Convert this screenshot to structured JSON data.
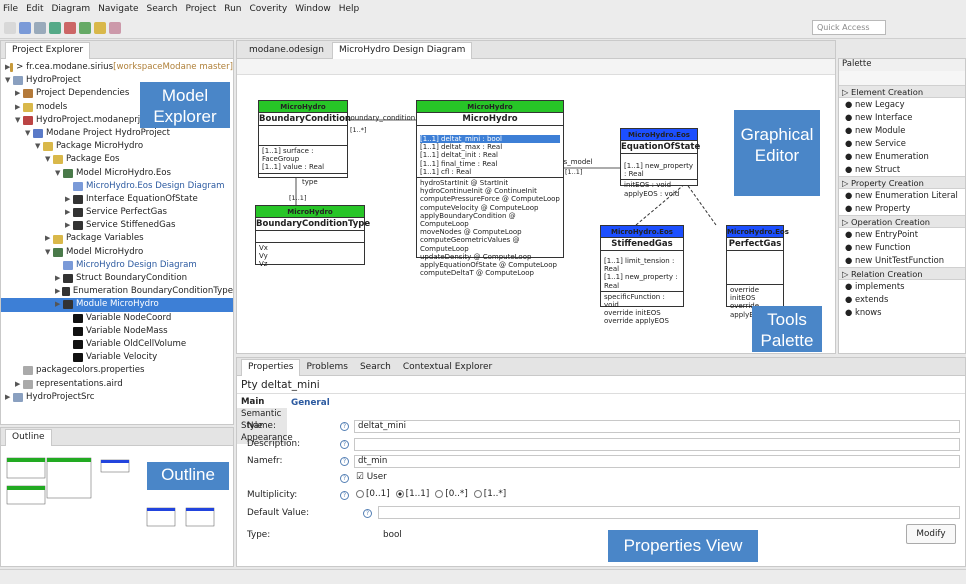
{
  "menu": [
    "File",
    "Edit",
    "Diagram",
    "Navigate",
    "Search",
    "Project",
    "Run",
    "Coverity",
    "Window",
    "Help"
  ],
  "quick_access": "Quick Access",
  "explorer": {
    "tab": "Project Explorer",
    "items": [
      {
        "t": "> fr.cea.modane.sirius",
        "s": " [workspaceModane master]",
        "ind": 0,
        "ar": "▶",
        "c": "#c79a3a"
      },
      {
        "t": "HydroProject",
        "ind": 0,
        "ar": "▼",
        "c": "#8aa0c0"
      },
      {
        "t": "Project Dependencies",
        "ind": 1,
        "ar": "▶",
        "c": "#b47a3a"
      },
      {
        "t": "models",
        "ind": 1,
        "ar": "▶",
        "c": "#d9b84a"
      },
      {
        "t": "HydroProject.modaneprj",
        "ind": 1,
        "ar": "▼",
        "c": "#b44"
      },
      {
        "t": "Modane Project HydroProject",
        "ind": 2,
        "ar": "▼",
        "c": "#5a7ac8"
      },
      {
        "t": "Package MicroHydro",
        "ind": 3,
        "ar": "▼",
        "c": "#d9b84a"
      },
      {
        "t": "Package Eos",
        "ind": 4,
        "ar": "▼",
        "c": "#d9b84a"
      },
      {
        "t": "Model MicroHydro.Eos",
        "ind": 5,
        "ar": "▼",
        "c": "#4a7a4a"
      },
      {
        "t": "MicroHydro.Eos Design Diagram",
        "ind": 6,
        "ar": "",
        "c": "#7a9ad8",
        "lnk": true
      },
      {
        "t": "Interface EquationOfState",
        "ind": 6,
        "ar": "▶",
        "c": "#333"
      },
      {
        "t": "Service PerfectGas",
        "ind": 6,
        "ar": "▶",
        "c": "#333"
      },
      {
        "t": "Service StiffenedGas",
        "ind": 6,
        "ar": "▶",
        "c": "#333"
      },
      {
        "t": "Package Variables",
        "ind": 4,
        "ar": "▶",
        "c": "#d9b84a"
      },
      {
        "t": "Model MicroHydro",
        "ind": 4,
        "ar": "▼",
        "c": "#4a7a4a"
      },
      {
        "t": "MicroHydro Design Diagram",
        "ind": 5,
        "ar": "",
        "c": "#7a9ad8",
        "lnk": true
      },
      {
        "t": "Struct BoundaryCondition",
        "ind": 5,
        "ar": "▶",
        "c": "#333"
      },
      {
        "t": "Enumeration BoundaryConditionType",
        "ind": 5,
        "ar": "▶",
        "c": "#333"
      },
      {
        "t": "Module MicroHydro",
        "ind": 5,
        "ar": "▶",
        "c": "#333",
        "sel": true
      },
      {
        "t": "Variable NodeCoord",
        "ind": 6,
        "ar": "",
        "c": "#111"
      },
      {
        "t": "Variable NodeMass",
        "ind": 6,
        "ar": "",
        "c": "#111"
      },
      {
        "t": "Variable OldCellVolume",
        "ind": 6,
        "ar": "",
        "c": "#111"
      },
      {
        "t": "Variable Velocity",
        "ind": 6,
        "ar": "",
        "c": "#111"
      },
      {
        "t": "packagecolors.properties",
        "ind": 1,
        "ar": "",
        "c": "#aaa"
      },
      {
        "t": "representations.aird",
        "ind": 1,
        "ar": "▶",
        "c": "#aaa"
      },
      {
        "t": "HydroProjectSrc",
        "ind": 0,
        "ar": "▶",
        "c": "#8aa0c0"
      }
    ]
  },
  "outline_tab": "Outline",
  "editor_tabs": [
    "modane.odesign",
    "MicroHydro Design Diagram"
  ],
  "callouts": {
    "model_explorer": "Model Explorer",
    "graphical_editor": "Graphical Editor",
    "outline": "Outline",
    "tools_palette": "Tools Palette",
    "properties_view": "Properties View"
  },
  "diagram": {
    "bc": {
      "hd": "MicroHydro",
      "nm": "BoundaryCondition",
      "attrs": [
        "[1..1] surface : FaceGroup",
        "[1..1] value : Real"
      ]
    },
    "bct": {
      "hd": "MicroHydro",
      "nm": "BoundaryConditionType",
      "lits": [
        "Vx",
        "Vy",
        "Vz"
      ]
    },
    "mh": {
      "hd": "MicroHydro",
      "nm": "MicroHydro",
      "sel_attr": "[1..1] deltat_mini : bool",
      "attrs": [
        "[1..1] deltat_max : Real",
        "[1..1] deltat_init : Real",
        "[1..1] final_time : Real",
        "[1..1] cfl : Real"
      ],
      "ops": [
        "hydroStartInit @ StartInit",
        "hydroContinueInit @ ContinueInit",
        "computePressureForce @ ComputeLoop",
        "computeVelocity @ ComputeLoop",
        "applyBoundaryCondition @ ComputeLoop",
        "moveNodes @ ComputeLoop",
        "computeGeometricValues @ ComputeLoop",
        "updateDensity @ ComputeLoop",
        "applyEquationOfState @ ComputeLoop",
        "computeDeltaT @ ComputeLoop"
      ]
    },
    "eos": {
      "hd": "MicroHydro.Eos",
      "nm": "EquationOfState",
      "attrs": [
        "[1..1] new_property : Real"
      ],
      "ops": [
        "initEOS : void",
        "applyEOS : void"
      ]
    },
    "sg": {
      "hd": "MicroHydro.Eos",
      "nm": "StiffenedGas",
      "attrs": [
        "[1..1] limit_tension : Real",
        "[1..1] new_property : Real"
      ],
      "ops": [
        "specificFunction : void",
        "override initEOS",
        "override applyEOS"
      ]
    },
    "pg": {
      "hd": "MicroHydro.Eos",
      "nm": "PerfectGas",
      "ops": [
        "override initEOS",
        "override applyEOS"
      ]
    },
    "labels": {
      "bc_link": "boundary_condition",
      "bc_mult": "[1..*]",
      "type": "type",
      "type_mult": "[1..1]",
      "eos": "eos_model",
      "eos_mult": "[1..1]"
    }
  },
  "palette": {
    "title": "Palette",
    "groups": [
      {
        "h": "Element Creation",
        "items": [
          "new Legacy",
          "new Interface",
          "new Module",
          "new Service",
          "new Enumeration",
          "new Struct"
        ]
      },
      {
        "h": "Property Creation",
        "items": [
          "new Enumeration Literal",
          "new Property"
        ]
      },
      {
        "h": "Operation Creation",
        "items": [
          "new EntryPoint",
          "new Function",
          "new UnitTestFunction"
        ]
      },
      {
        "h": "Relation Creation",
        "items": [
          "implements",
          "extends",
          "knows"
        ]
      }
    ]
  },
  "props": {
    "tabs": [
      "Properties",
      "Problems",
      "Search",
      "Contextual Explorer"
    ],
    "title": "Pty deltat_mini",
    "side": [
      "Main",
      "Semantic",
      "Style",
      "Appearance"
    ],
    "section": "General",
    "labels": {
      "name": "Name:",
      "desc": "Description:",
      "namefr": "Namefr:",
      "mult": "Multiplicity:",
      "def": "Default Value:",
      "type": "Type:"
    },
    "values": {
      "name": "deltat_mini",
      "desc": "",
      "namefr": "dt_min",
      "user": "User",
      "type": "bool"
    },
    "mult_opts": [
      "[0..1]",
      "[1..1]",
      "[0..*]",
      "[1..*]"
    ],
    "modify": "Modify"
  }
}
